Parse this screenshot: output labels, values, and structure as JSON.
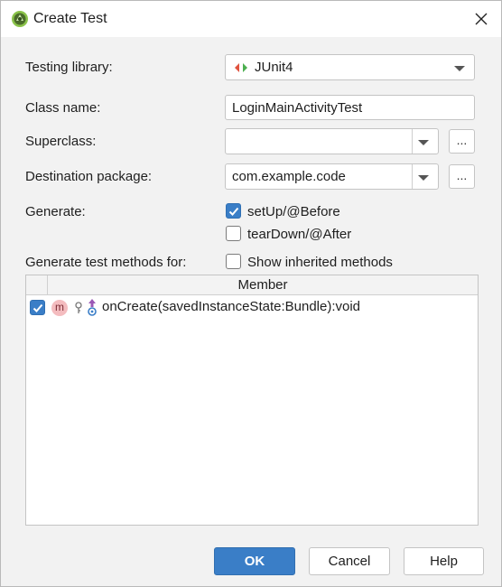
{
  "window": {
    "title": "Create Test",
    "app_icon": "android-studio-icon",
    "close_icon": "close-icon"
  },
  "form": {
    "testing_library": {
      "label": "Testing library:",
      "value": "JUnit4",
      "icon": "junit-icon"
    },
    "class_name": {
      "label": "Class name:",
      "value": "LoginMainActivityTest"
    },
    "superclass": {
      "label": "Superclass:",
      "value": "",
      "browse_label": "..."
    },
    "destination_package": {
      "label": "Destination package:",
      "value": "com.example.code",
      "browse_label": "..."
    },
    "generate": {
      "label": "Generate:",
      "setup": {
        "label": "setUp/@Before",
        "checked": true
      },
      "teardown": {
        "label": "tearDown/@After",
        "checked": false
      }
    },
    "generate_methods": {
      "label": "Generate test methods for:",
      "show_inherited": {
        "label": "Show inherited methods",
        "checked": false
      }
    }
  },
  "members_table": {
    "header": "Member",
    "rows": [
      {
        "checked": true,
        "badge": "m",
        "signature": "onCreate(savedInstanceState:Bundle):void",
        "icons": [
          "method-icon",
          "protected-visibility-icon",
          "override-icon"
        ]
      }
    ]
  },
  "buttons": {
    "ok": "OK",
    "cancel": "Cancel",
    "help": "Help"
  },
  "colors": {
    "accent": "#3a7ec7",
    "method_badge": "#f4bcbf"
  }
}
